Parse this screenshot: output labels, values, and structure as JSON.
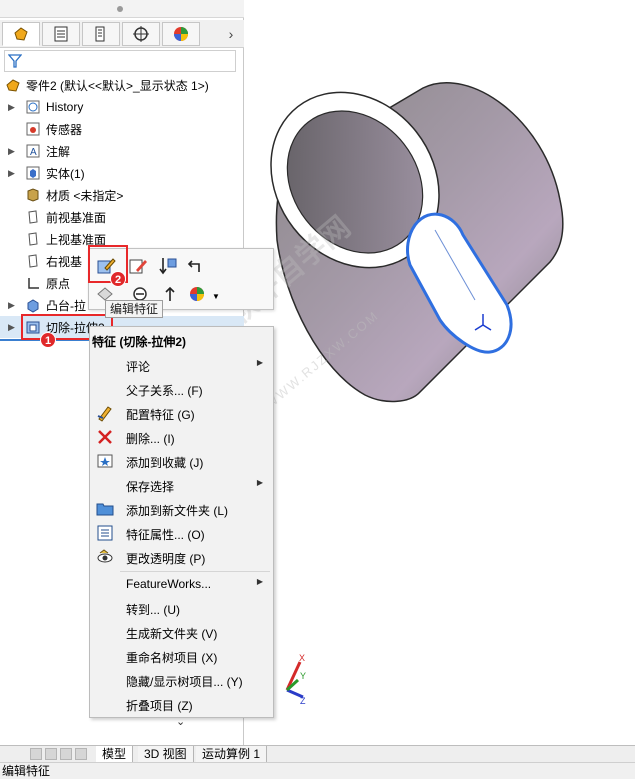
{
  "panel": {
    "root_label": "零件2 (默认<<默认>_显示状态 1>)",
    "items": [
      {
        "label": "History",
        "icon": "history-icon",
        "arrow": true
      },
      {
        "label": "传感器",
        "icon": "sensor-icon",
        "arrow": false
      },
      {
        "label": "注解",
        "icon": "annotation-icon",
        "arrow": true
      },
      {
        "label": "实体(1)",
        "icon": "solid-body-icon",
        "arrow": true
      },
      {
        "label": "材质 <未指定>",
        "icon": "material-icon",
        "arrow": false
      },
      {
        "label": "前视基准面",
        "icon": "plane-icon",
        "arrow": false
      },
      {
        "label": "上视基准面",
        "icon": "plane-icon",
        "arrow": false
      },
      {
        "label": "右视基",
        "icon": "plane-icon",
        "arrow": false
      },
      {
        "label": "原点",
        "icon": "origin-icon",
        "arrow": false
      },
      {
        "label": "凸台-拉",
        "icon": "boss-extrude-icon",
        "arrow": true
      },
      {
        "label": "切除-拉伸2",
        "icon": "cut-extrude-icon",
        "arrow": true
      }
    ]
  },
  "tooltip": "编辑特征",
  "badges": [
    "1",
    "2"
  ],
  "menu": {
    "title": "特征 (切除-拉伸2)",
    "items": [
      {
        "label": "评论",
        "submenu": true,
        "icon": ""
      },
      {
        "label": "父子关系... (F)",
        "submenu": false,
        "icon": ""
      },
      {
        "label": "配置特征 (G)",
        "submenu": false,
        "icon": "configure-feature-icon"
      },
      {
        "label": "删除... (I)",
        "submenu": false,
        "icon": "delete-icon"
      },
      {
        "label": "添加到收藏 (J)",
        "submenu": false,
        "icon": "favorite-icon"
      },
      {
        "label": "保存选择",
        "submenu": true,
        "icon": ""
      },
      {
        "label": "添加到新文件夹 (L)",
        "submenu": false,
        "icon": "folder-icon"
      },
      {
        "label": "特征属性... (O)",
        "submenu": false,
        "icon": "properties-icon"
      },
      {
        "label": "更改透明度 (P)",
        "submenu": false,
        "icon": "transparency-icon"
      },
      {
        "label": "FeatureWorks...",
        "submenu": true,
        "icon": ""
      },
      {
        "label": "转到... (U)",
        "submenu": false,
        "icon": ""
      },
      {
        "label": "生成新文件夹 (V)",
        "submenu": false,
        "icon": ""
      },
      {
        "label": "重命名树项目 (X)",
        "submenu": false,
        "icon": ""
      },
      {
        "label": "隐藏/显示树项目... (Y)",
        "submenu": false,
        "icon": ""
      },
      {
        "label": "折叠项目 (Z)",
        "submenu": false,
        "icon": ""
      }
    ],
    "more_glyph": "⌄"
  },
  "bottom_tabs": [
    "模型",
    "3D 视图",
    "运动算例 1"
  ],
  "status_text": "编辑特征",
  "triad": {
    "x": "X",
    "y": "Y",
    "z": "Z"
  },
  "watermark": "软件自学网",
  "watermark_url": "WWW.RJZXW.COM",
  "colors": {
    "highlight": "#e8282a",
    "selection": "#d9e8f6",
    "cylinder": "#8f8a91",
    "cut_edge": "#2f6fe0"
  }
}
